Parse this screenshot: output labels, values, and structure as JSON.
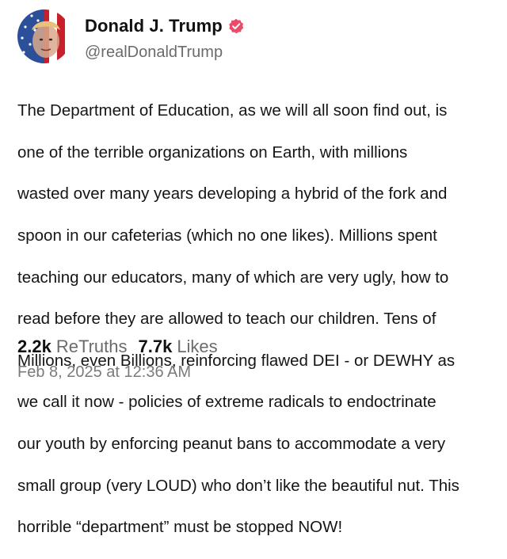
{
  "author": {
    "display_name": "Donald J. Trump",
    "handle": "@realDonaldTrump",
    "avatar_icon": "profile-avatar-flag",
    "verified_icon": "verified-badge-icon",
    "verified_color": "#e94b6b"
  },
  "post": {
    "lines": [
      "The Department of Education, as we will all soon find out, is",
      "one of the terrible organizations on Earth, with millions",
      "wasted over many years developing a hybrid of the fork and",
      "spoon in our cafeterias (which no one likes). Millions spent",
      "teaching our educators, many of which are very ugly, how to",
      "read before they are allowed to teach our children. Tens of",
      "Millions, even Billions, reinforcing flawed DEI - or DEWHY as",
      "we call it now - policies of extreme radicals to endoctrinate",
      "our youth by enforcing peanut bans to accommodate a very",
      "small group (very LOUD) who don’t like the beautiful nut. This",
      "horrible “department” must be stopped NOW!"
    ]
  },
  "stats": {
    "retruths_count": "2.2k",
    "retruths_label": "ReTruths",
    "likes_count": "7.7k",
    "likes_label": "Likes"
  },
  "timestamp": "Feb 8, 2025 at 12:36 AM"
}
